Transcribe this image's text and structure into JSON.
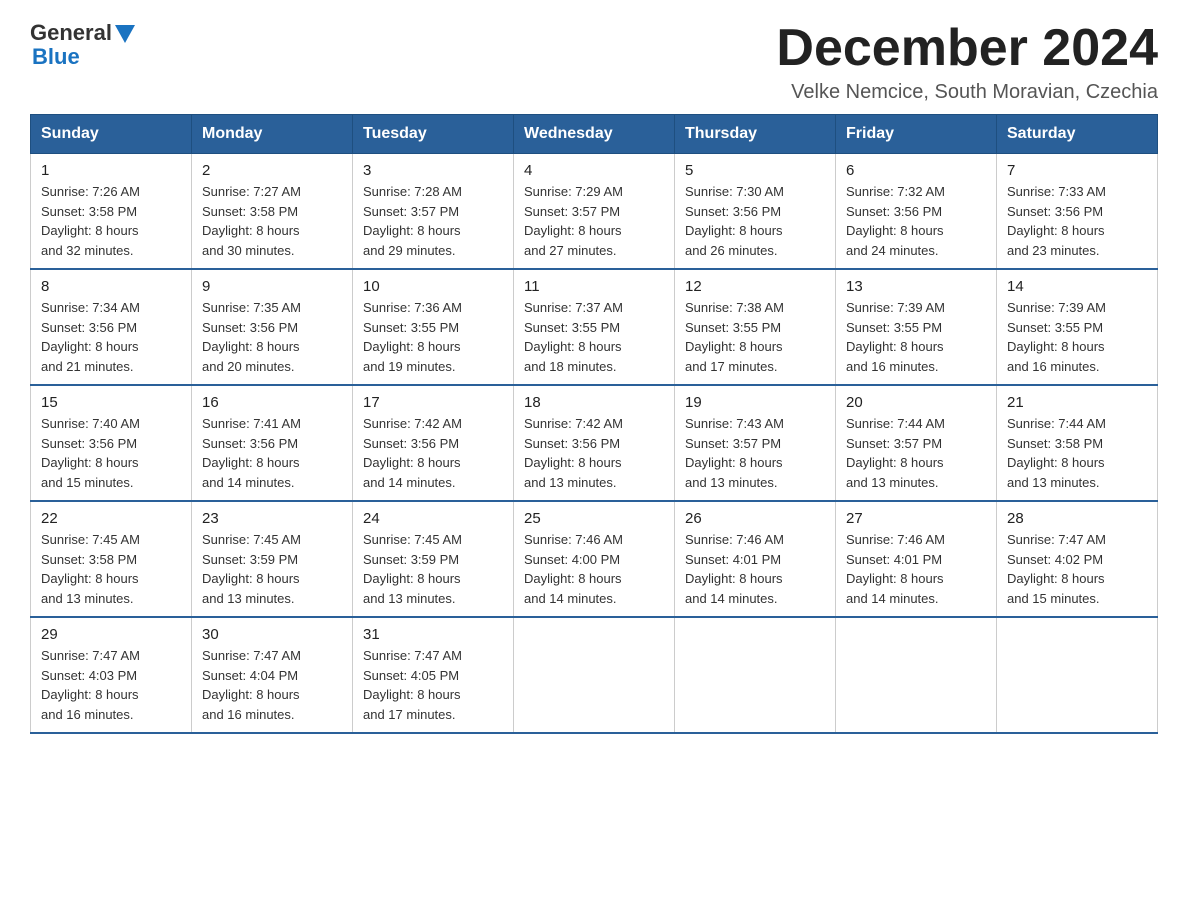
{
  "logo": {
    "general": "General",
    "blue": "Blue"
  },
  "title": "December 2024",
  "location": "Velke Nemcice, South Moravian, Czechia",
  "headers": [
    "Sunday",
    "Monday",
    "Tuesday",
    "Wednesday",
    "Thursday",
    "Friday",
    "Saturday"
  ],
  "weeks": [
    [
      {
        "day": "1",
        "sunrise": "7:26 AM",
        "sunset": "3:58 PM",
        "daylight": "8 hours and 32 minutes."
      },
      {
        "day": "2",
        "sunrise": "7:27 AM",
        "sunset": "3:58 PM",
        "daylight": "8 hours and 30 minutes."
      },
      {
        "day": "3",
        "sunrise": "7:28 AM",
        "sunset": "3:57 PM",
        "daylight": "8 hours and 29 minutes."
      },
      {
        "day": "4",
        "sunrise": "7:29 AM",
        "sunset": "3:57 PM",
        "daylight": "8 hours and 27 minutes."
      },
      {
        "day": "5",
        "sunrise": "7:30 AM",
        "sunset": "3:56 PM",
        "daylight": "8 hours and 26 minutes."
      },
      {
        "day": "6",
        "sunrise": "7:32 AM",
        "sunset": "3:56 PM",
        "daylight": "8 hours and 24 minutes."
      },
      {
        "day": "7",
        "sunrise": "7:33 AM",
        "sunset": "3:56 PM",
        "daylight": "8 hours and 23 minutes."
      }
    ],
    [
      {
        "day": "8",
        "sunrise": "7:34 AM",
        "sunset": "3:56 PM",
        "daylight": "8 hours and 21 minutes."
      },
      {
        "day": "9",
        "sunrise": "7:35 AM",
        "sunset": "3:56 PM",
        "daylight": "8 hours and 20 minutes."
      },
      {
        "day": "10",
        "sunrise": "7:36 AM",
        "sunset": "3:55 PM",
        "daylight": "8 hours and 19 minutes."
      },
      {
        "day": "11",
        "sunrise": "7:37 AM",
        "sunset": "3:55 PM",
        "daylight": "8 hours and 18 minutes."
      },
      {
        "day": "12",
        "sunrise": "7:38 AM",
        "sunset": "3:55 PM",
        "daylight": "8 hours and 17 minutes."
      },
      {
        "day": "13",
        "sunrise": "7:39 AM",
        "sunset": "3:55 PM",
        "daylight": "8 hours and 16 minutes."
      },
      {
        "day": "14",
        "sunrise": "7:39 AM",
        "sunset": "3:55 PM",
        "daylight": "8 hours and 16 minutes."
      }
    ],
    [
      {
        "day": "15",
        "sunrise": "7:40 AM",
        "sunset": "3:56 PM",
        "daylight": "8 hours and 15 minutes."
      },
      {
        "day": "16",
        "sunrise": "7:41 AM",
        "sunset": "3:56 PM",
        "daylight": "8 hours and 14 minutes."
      },
      {
        "day": "17",
        "sunrise": "7:42 AM",
        "sunset": "3:56 PM",
        "daylight": "8 hours and 14 minutes."
      },
      {
        "day": "18",
        "sunrise": "7:42 AM",
        "sunset": "3:56 PM",
        "daylight": "8 hours and 13 minutes."
      },
      {
        "day": "19",
        "sunrise": "7:43 AM",
        "sunset": "3:57 PM",
        "daylight": "8 hours and 13 minutes."
      },
      {
        "day": "20",
        "sunrise": "7:44 AM",
        "sunset": "3:57 PM",
        "daylight": "8 hours and 13 minutes."
      },
      {
        "day": "21",
        "sunrise": "7:44 AM",
        "sunset": "3:58 PM",
        "daylight": "8 hours and 13 minutes."
      }
    ],
    [
      {
        "day": "22",
        "sunrise": "7:45 AM",
        "sunset": "3:58 PM",
        "daylight": "8 hours and 13 minutes."
      },
      {
        "day": "23",
        "sunrise": "7:45 AM",
        "sunset": "3:59 PM",
        "daylight": "8 hours and 13 minutes."
      },
      {
        "day": "24",
        "sunrise": "7:45 AM",
        "sunset": "3:59 PM",
        "daylight": "8 hours and 13 minutes."
      },
      {
        "day": "25",
        "sunrise": "7:46 AM",
        "sunset": "4:00 PM",
        "daylight": "8 hours and 14 minutes."
      },
      {
        "day": "26",
        "sunrise": "7:46 AM",
        "sunset": "4:01 PM",
        "daylight": "8 hours and 14 minutes."
      },
      {
        "day": "27",
        "sunrise": "7:46 AM",
        "sunset": "4:01 PM",
        "daylight": "8 hours and 14 minutes."
      },
      {
        "day": "28",
        "sunrise": "7:47 AM",
        "sunset": "4:02 PM",
        "daylight": "8 hours and 15 minutes."
      }
    ],
    [
      {
        "day": "29",
        "sunrise": "7:47 AM",
        "sunset": "4:03 PM",
        "daylight": "8 hours and 16 minutes."
      },
      {
        "day": "30",
        "sunrise": "7:47 AM",
        "sunset": "4:04 PM",
        "daylight": "8 hours and 16 minutes."
      },
      {
        "day": "31",
        "sunrise": "7:47 AM",
        "sunset": "4:05 PM",
        "daylight": "8 hours and 17 minutes."
      },
      null,
      null,
      null,
      null
    ]
  ],
  "labels": {
    "sunrise": "Sunrise:",
    "sunset": "Sunset:",
    "daylight": "Daylight:"
  }
}
